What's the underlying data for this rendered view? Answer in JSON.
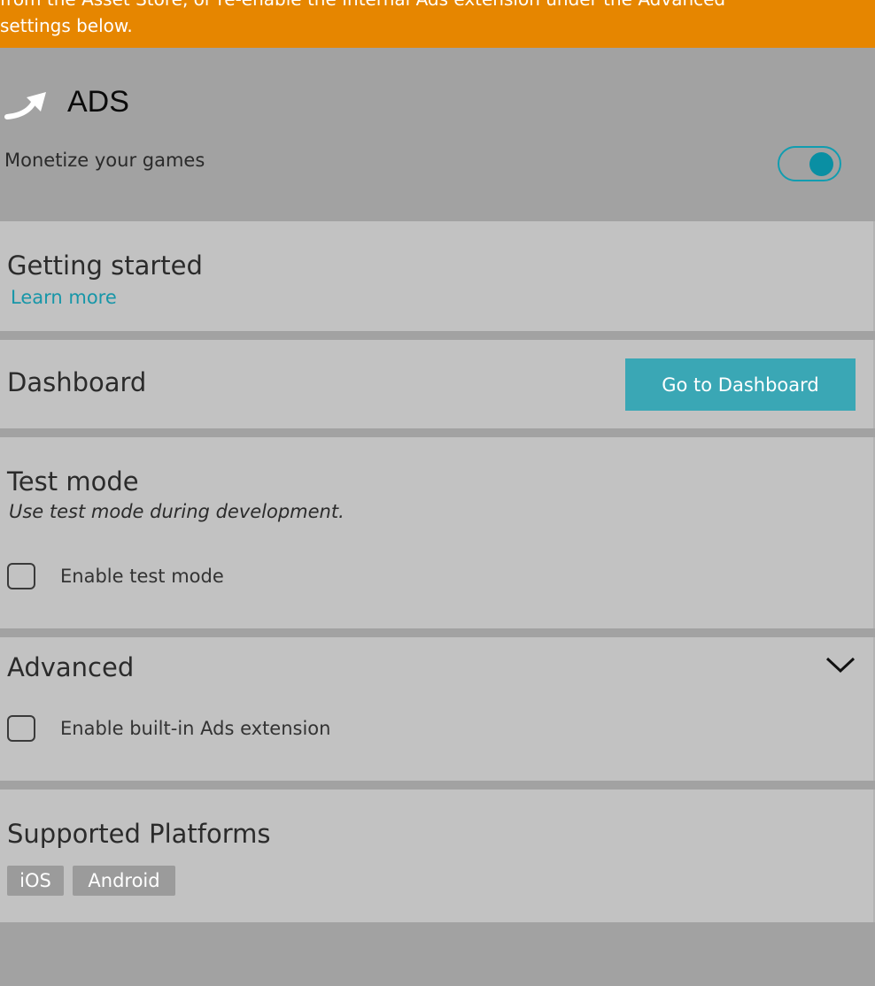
{
  "banner": {
    "line1": "from the Asset Store, or re-enable the Internal Ads extension under the Advanced",
    "line2": "settings below.",
    "color": "#e68600"
  },
  "header": {
    "icon": "ads-arrow-icon",
    "title": "ADS",
    "subtitle": "Monetize your games",
    "toggle_on": true
  },
  "getting_started": {
    "title": "Getting started",
    "link": "Learn more"
  },
  "dashboard": {
    "title": "Dashboard",
    "button": "Go to Dashboard"
  },
  "test_mode": {
    "title": "Test mode",
    "note": "Use test mode during development.",
    "checkbox_label": "Enable test mode",
    "checked": false
  },
  "advanced": {
    "title": "Advanced",
    "icon": "chevron-down-icon",
    "checkbox_label": "Enable built-in Ads extension",
    "checked": false
  },
  "platforms": {
    "title": "Supported Platforms",
    "tags": [
      "iOS",
      "Android"
    ]
  },
  "colors": {
    "accent": "#3aa7b5",
    "link": "#1796a8",
    "panel": "#c2c2c2",
    "background": "#a2a2a2"
  }
}
